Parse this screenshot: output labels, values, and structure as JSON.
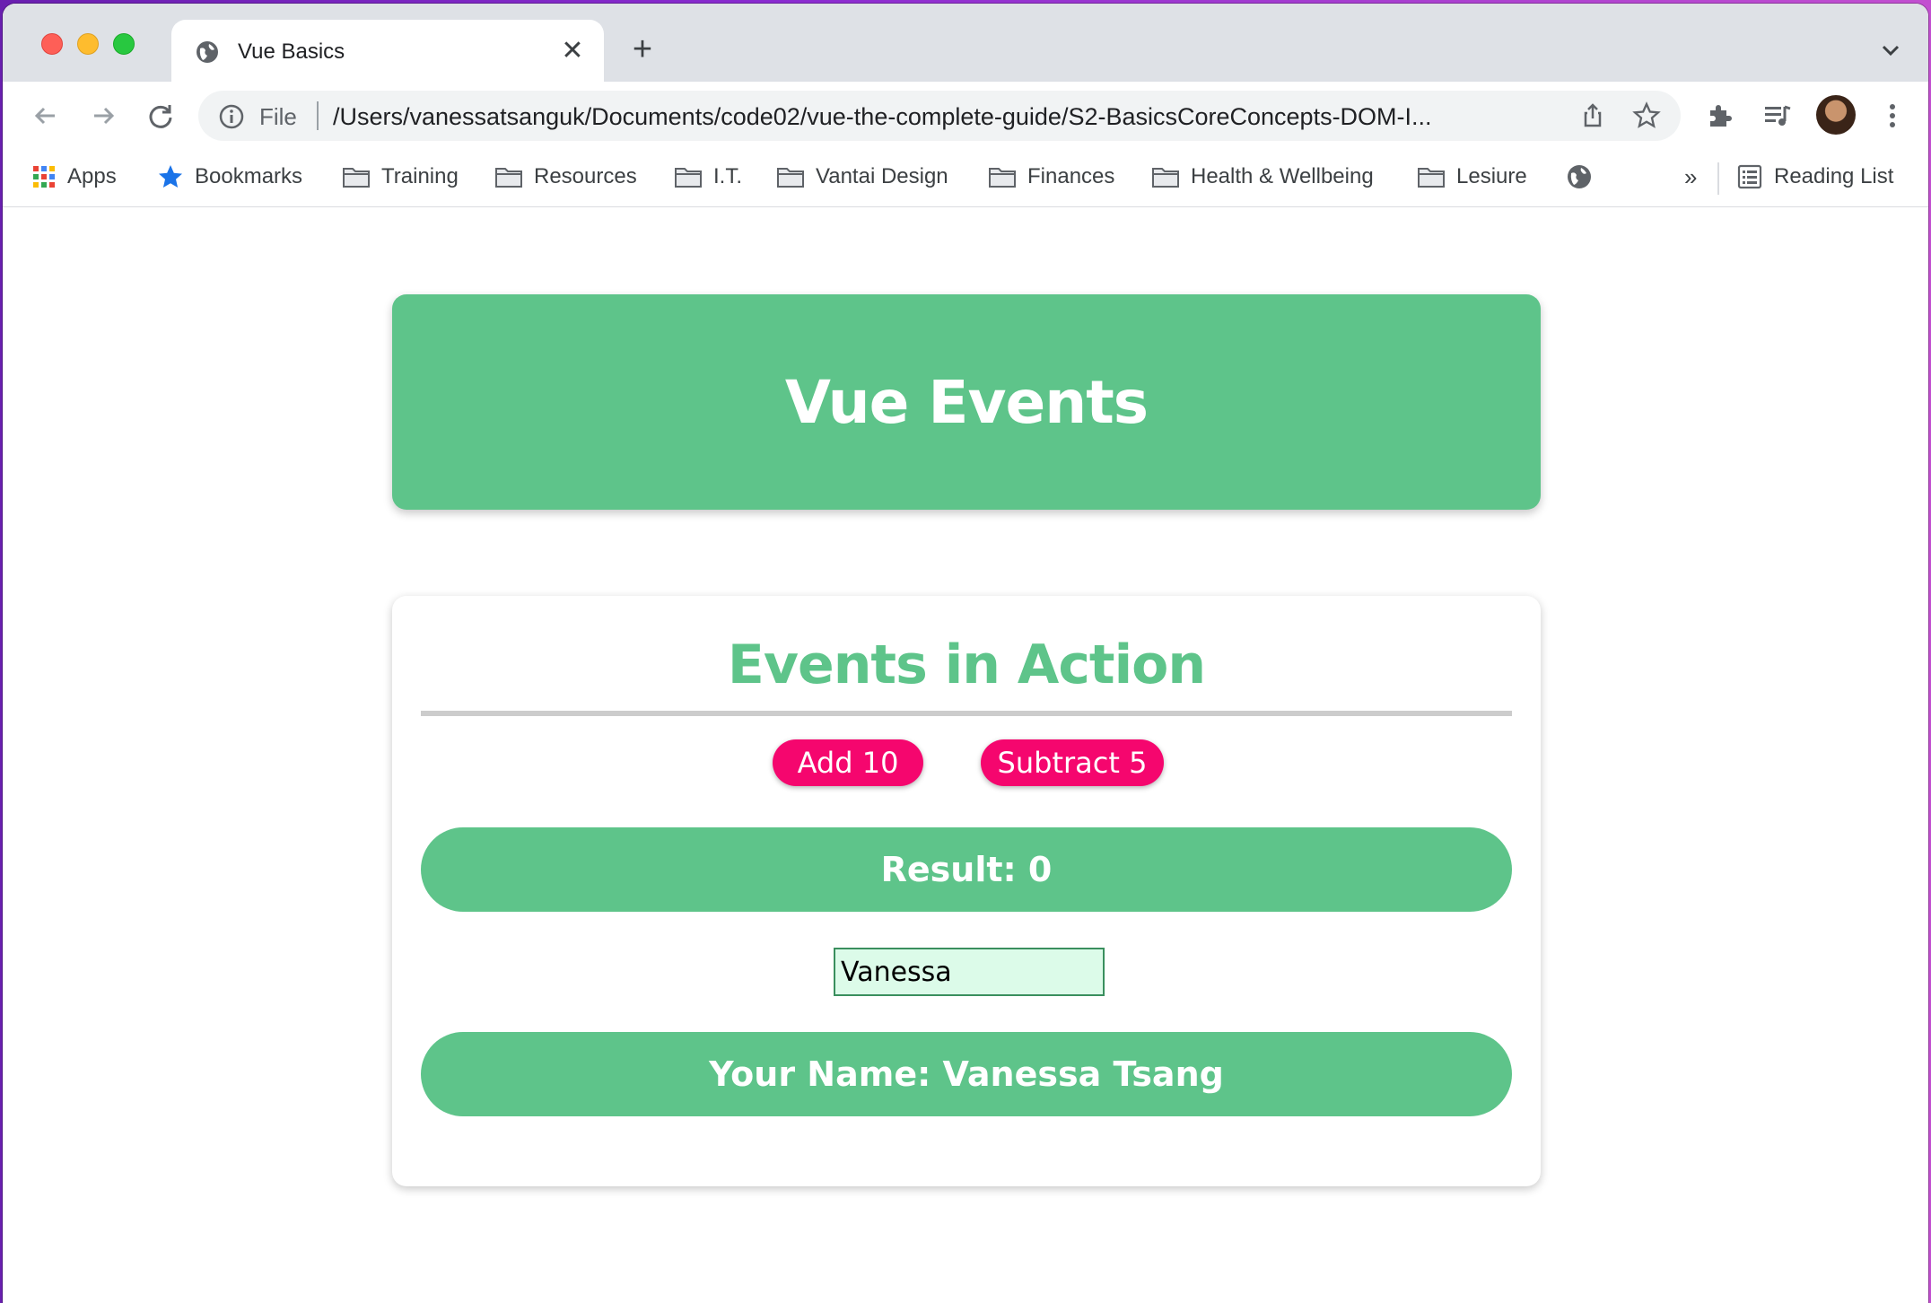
{
  "browser": {
    "tab": {
      "title": "Vue Basics"
    },
    "address": {
      "scheme": "File",
      "url": "/Users/vanessatsanguk/Documents/code02/vue-the-complete-guide/S2-BasicsCoreConcepts-DOM-I..."
    },
    "bookmarks": [
      {
        "label": "Apps",
        "icon": "apps-grid-icon"
      },
      {
        "label": "Bookmarks",
        "icon": "star-icon"
      },
      {
        "label": "Training",
        "icon": "folder-icon"
      },
      {
        "label": "Resources",
        "icon": "folder-icon"
      },
      {
        "label": "I.T.",
        "icon": "folder-icon"
      },
      {
        "label": "Vantai Design",
        "icon": "folder-icon"
      },
      {
        "label": "Finances",
        "icon": "folder-icon"
      },
      {
        "label": "Health & Wellbeing",
        "icon": "folder-icon"
      },
      {
        "label": "Lesiure",
        "icon": "folder-icon"
      }
    ],
    "overflow_label": "»",
    "reading_list": "Reading List"
  },
  "page": {
    "header_title": "Vue Events",
    "section_title": "Events in Action",
    "add_button": "Add 10",
    "subtract_button": "Subtract 5",
    "result_text": "Result: 0",
    "name_input_value": "Vanessa",
    "name_text": "Your Name: Vanessa Tsang"
  },
  "colors": {
    "accent_green": "#5ec48a",
    "button_pink": "#f5066e",
    "input_bg": "#dcfbe9"
  }
}
